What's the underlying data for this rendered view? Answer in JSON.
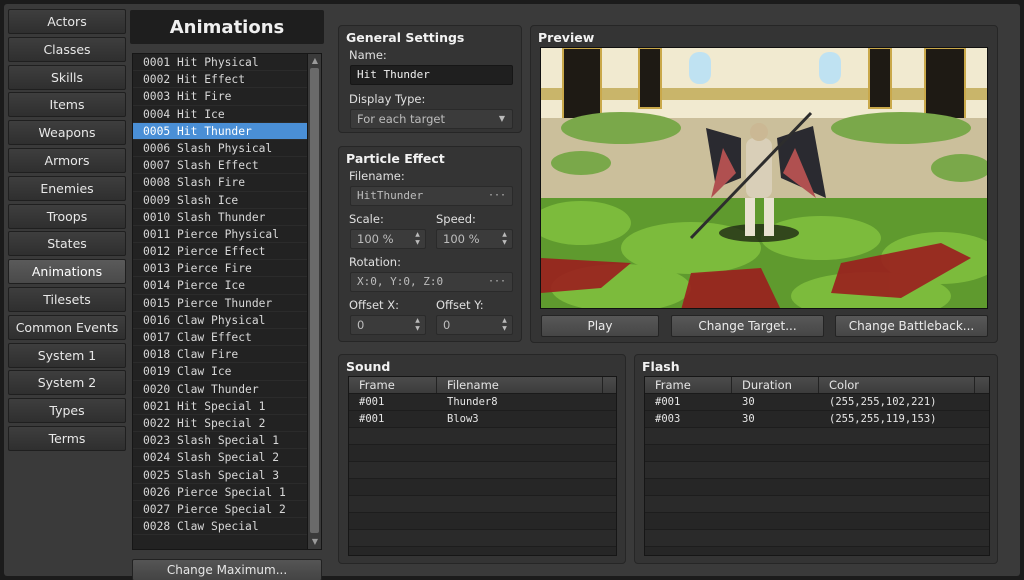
{
  "nav": [
    "Actors",
    "Classes",
    "Skills",
    "Items",
    "Weapons",
    "Armors",
    "Enemies",
    "Troops",
    "States",
    "Animations",
    "Tilesets",
    "Common Events",
    "System 1",
    "System 2",
    "Types",
    "Terms"
  ],
  "nav_active": "Animations",
  "list": {
    "title": "Animations",
    "items": [
      "0001 Hit Physical",
      "0002 Hit Effect",
      "0003 Hit Fire",
      "0004 Hit Ice",
      "0005 Hit Thunder",
      "0006 Slash Physical",
      "0007 Slash Effect",
      "0008 Slash Fire",
      "0009 Slash Ice",
      "0010 Slash Thunder",
      "0011 Pierce Physical",
      "0012 Pierce Effect",
      "0013 Pierce Fire",
      "0014 Pierce Ice",
      "0015 Pierce Thunder",
      "0016 Claw Physical",
      "0017 Claw Effect",
      "0018 Claw Fire",
      "0019 Claw Ice",
      "0020 Claw Thunder",
      "0021 Hit Special 1",
      "0022 Hit Special 2",
      "0023 Slash Special 1",
      "0024 Slash Special 2",
      "0025 Slash Special 3",
      "0026 Pierce Special 1",
      "0027 Pierce Special 2",
      "0028 Claw Special"
    ],
    "selected_index": 4,
    "change_maximum": "Change Maximum..."
  },
  "general": {
    "title": "General Settings",
    "name_label": "Name:",
    "name_value": "Hit Thunder",
    "display_type_label": "Display Type:",
    "display_type_value": "For each target"
  },
  "particle": {
    "title": "Particle Effect",
    "filename_label": "Filename:",
    "filename_value": "HitThunder",
    "scale_label": "Scale:",
    "scale_value": "100 %",
    "speed_label": "Speed:",
    "speed_value": "100 %",
    "rotation_label": "Rotation:",
    "rotation_value": "X:0, Y:0, Z:0",
    "offset_x_label": "Offset X:",
    "offset_x_value": "0",
    "offset_y_label": "Offset Y:",
    "offset_y_value": "0"
  },
  "preview": {
    "title": "Preview",
    "play": "Play",
    "change_target": "Change Target...",
    "change_battleback": "Change Battleback..."
  },
  "sound": {
    "title": "Sound",
    "columns": [
      "Frame",
      "Filename"
    ],
    "rows": [
      [
        "#001",
        "Thunder8"
      ],
      [
        "#001",
        "Blow3"
      ]
    ]
  },
  "flash": {
    "title": "Flash",
    "columns": [
      "Frame",
      "Duration",
      "Color"
    ],
    "rows": [
      [
        "#001",
        "30",
        "(255,255,102,221)"
      ],
      [
        "#003",
        "30",
        "(255,255,119,153)"
      ]
    ]
  },
  "colors": {
    "selection": "#4a8fd6",
    "panel": "#343434",
    "background": "#3a3a3a"
  }
}
